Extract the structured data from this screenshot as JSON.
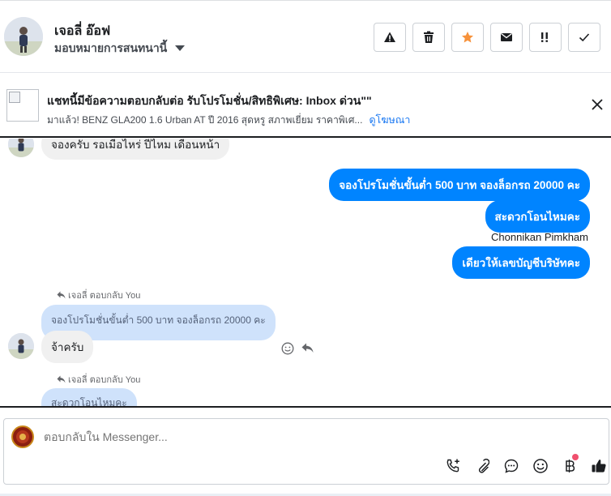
{
  "header": {
    "contact_name": "เจอลี่ อ๊อฟ",
    "assign_label": "มอบหมายการสนทนานี้",
    "actions": [
      {
        "icon": "warning-icon",
        "name": "spam-button"
      },
      {
        "icon": "trash-icon",
        "name": "delete-button"
      },
      {
        "icon": "star-icon",
        "name": "star-button",
        "color": "#f7923b"
      },
      {
        "icon": "envelope-icon",
        "name": "mark-unread-button"
      },
      {
        "icon": "follow-up-icon",
        "name": "follow-up-button"
      },
      {
        "icon": "check-icon",
        "name": "done-button"
      }
    ]
  },
  "ad": {
    "title": "แชทนี้มีข้อความตอบกลับต่อ รับโปรโมชั่น/สิทธิพิเศษ: Inbox ด่วน\"\"",
    "subtitle": "มาแล้ว! BENZ GLA200 1.6 Urban AT ปี 2016 สุดหรู สภาพเยี่ยม ราคาพิเศ...",
    "link": "ดูโฆษณา"
  },
  "messages": {
    "incoming_top": "จองครับ รอเมื่อไหร่ ปีไหม เดือนหน้า",
    "outgoing": [
      "จองโปรโมชั่นขั้นต่ำ 500 บาท จองล็อกรถ 20000 คะ",
      "สะดวกโอนไหมคะ",
      "เดียวให้เลขบัญชีบริษัทคะ"
    ],
    "sender_name": "Chonnikan Pimkham",
    "reply_label": "เจอลี่ ตอบกลับ You",
    "quoted_1": "จองโปรโมชั่นขั้นต่ำ 500 บาท จองล็อกรถ 20000 คะ",
    "reply_1": "จ้าครับ",
    "reply_label_2": "เจอลี่ ตอบกลับ You",
    "quoted_2": "สะดวกโอนไหมคะ"
  },
  "composer": {
    "placeholder": "ตอบกลับใน Messenger..."
  },
  "colors": {
    "outgoing_bubble": "#0084ff",
    "quote_bubble": "#cfe2fb",
    "link": "#1877f2",
    "like": "#1c1e21"
  }
}
